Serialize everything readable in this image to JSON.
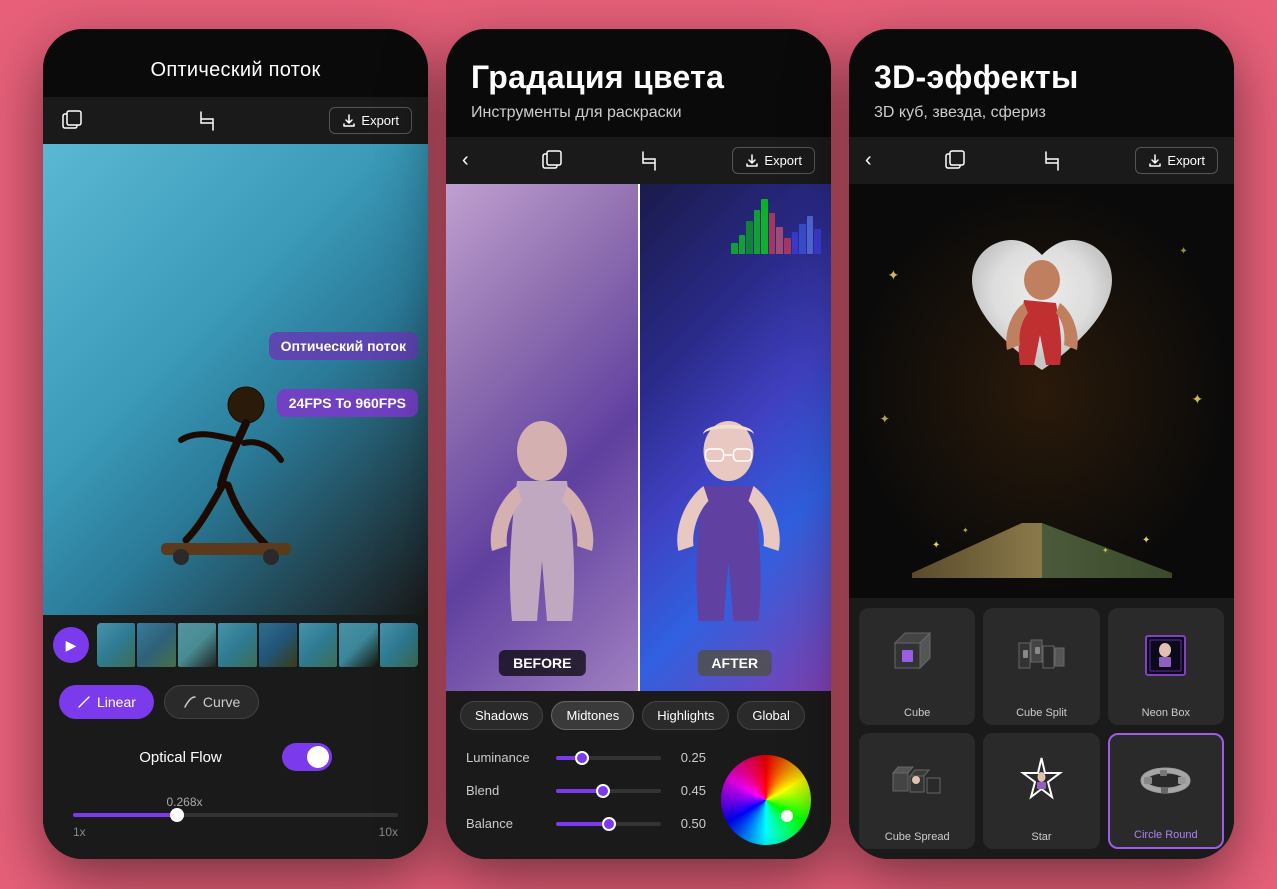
{
  "background_color": "#e8607a",
  "phones": [
    {
      "id": "phone1",
      "title": "Оптический поток",
      "toolbar": {
        "export_label": "Export"
      },
      "video_labels": {
        "optical_flow": "Оптический поток",
        "fps": "24FPS To 960FPS"
      },
      "curve_buttons": {
        "linear": "Linear",
        "curve": "Curve"
      },
      "optical_flow_label": "Optical Flow",
      "speed": {
        "value": "0.268x",
        "min": "1x",
        "max": "10x"
      }
    },
    {
      "id": "phone2",
      "title": "Градация цвета",
      "subtitle": "Инструменты для раскраски",
      "toolbar": {
        "export_label": "Export"
      },
      "labels": {
        "before": "BEFORE",
        "after": "AFTER"
      },
      "tabs": [
        "Shadows",
        "Midtones",
        "Highlights",
        "Global"
      ],
      "sliders": [
        {
          "label": "Luminance",
          "value": "0.25",
          "fill": 25
        },
        {
          "label": "Blend",
          "value": "0.45",
          "fill": 45
        },
        {
          "label": "Balance",
          "value": "0.50",
          "fill": 50
        }
      ]
    },
    {
      "id": "phone3",
      "title": "3D-эффекты",
      "subtitle": "3D куб, звезда, сфериз",
      "toolbar": {
        "export_label": "Export"
      },
      "effects": [
        {
          "id": "cube",
          "label": "Cube",
          "selected": false
        },
        {
          "id": "cube-split",
          "label": "Cube Split",
          "selected": false
        },
        {
          "id": "neon-box",
          "label": "Neon Box",
          "selected": false
        },
        {
          "id": "cube-spread",
          "label": "Cube Spread",
          "selected": false
        },
        {
          "id": "star",
          "label": "Star",
          "selected": false
        },
        {
          "id": "circle-round",
          "label": "Circle Round",
          "selected": true
        }
      ]
    }
  ]
}
